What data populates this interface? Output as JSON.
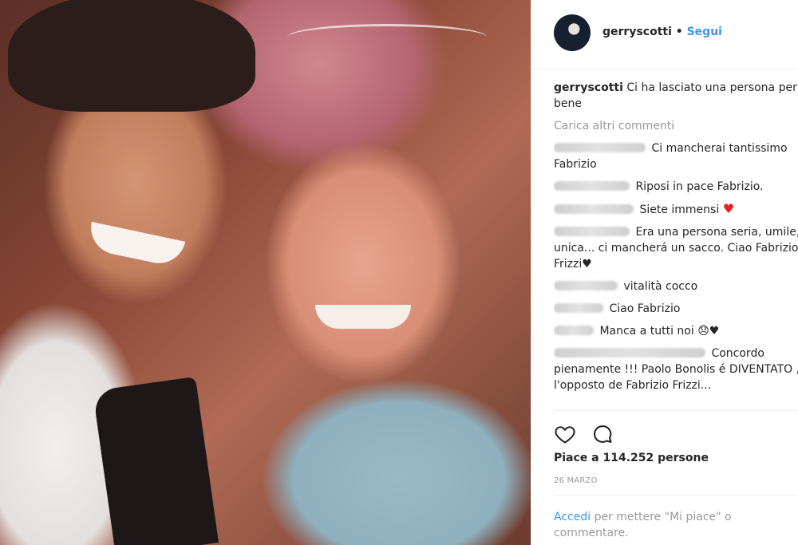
{
  "header": {
    "username": "gerryscotti",
    "separator": "•",
    "follow_label": "Segui"
  },
  "caption": {
    "username": "gerryscotti",
    "text": "Ci ha lasciato una persona per bene"
  },
  "load_more_label": "Carica altri commenti",
  "comments": [
    {
      "text": "Ci mancherai tantissimo Fabrizio"
    },
    {
      "text": "Riposi in pace Fabrizio."
    },
    {
      "text": "Siete immensi"
    },
    {
      "text": "Era una persona seria, umile, unica... ci mancherá un sacco. Ciao Fabrizio Frizzi♥"
    },
    {
      "text": "vitalità cocco"
    },
    {
      "text": "Ciao Fabrizio"
    },
    {
      "text": "Manca a tutti noi 😞♥"
    },
    {
      "text": "Concordo pienamente !!! Paolo Bonolis é DIVENTATO , l'opposto de Fabrizio Frizzi..."
    }
  ],
  "actions": {
    "like_icon": "heart-outline-icon",
    "comment_icon": "comment-bubble-icon"
  },
  "likes_text": "Piace a 114.252 persone",
  "date_text": "26 MARZO",
  "login_prompt": {
    "link": "Accedi",
    "rest": "per mettere \"Mi piace\" o commentare."
  },
  "colors": {
    "link_blue": "#3897f0",
    "text_dark": "#262626",
    "text_muted": "#999999",
    "heart_red": "#ed1c24"
  }
}
